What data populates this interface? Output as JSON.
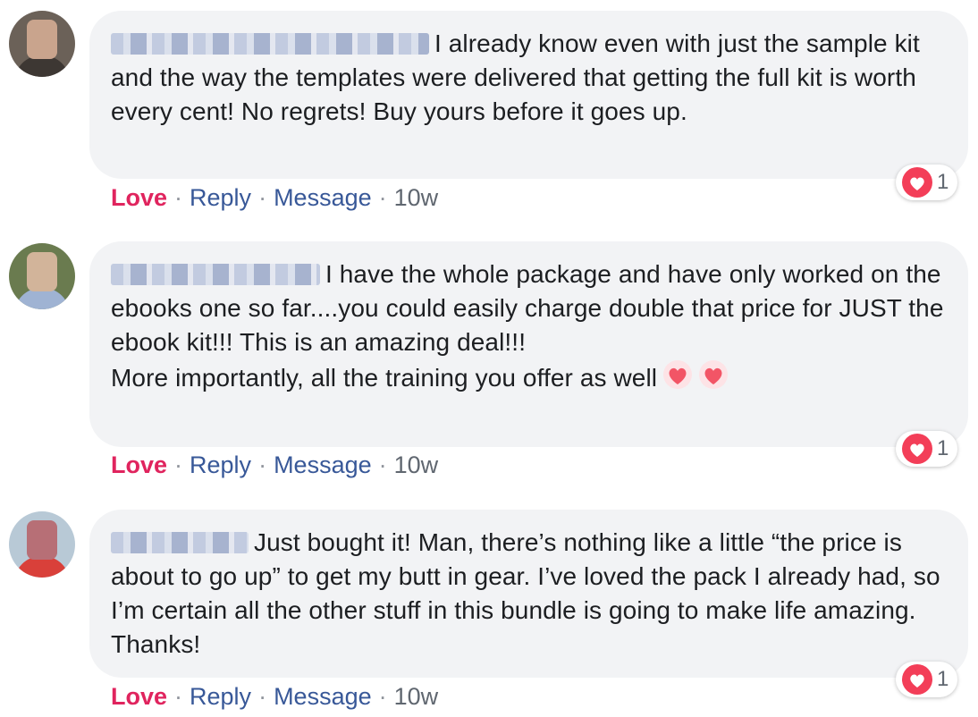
{
  "comments": [
    {
      "avatar_colors": [
        "#6b6158",
        "#3d3733",
        "#c9a48d"
      ],
      "paragraphs": [
        "I already know even with just the sample kit and the way the templates were delivered that getting the full kit is worth every cent! No regrets! Buy yours before it goes up."
      ],
      "reaction": {
        "icon": "heart-icon",
        "count": "1"
      },
      "actions": {
        "love": "Love",
        "reply": "Reply",
        "message": "Message",
        "time": "10w"
      }
    },
    {
      "avatar_colors": [
        "#6a7b4f",
        "#9fb3d3",
        "#d2b49a"
      ],
      "paragraphs": [
        "I have the whole package and have only worked on the ebooks one so far....you could easily charge double that price for JUST the ebook kit!!! This is an amazing deal!!!",
        "More importantly, all the training you offer as well"
      ],
      "emojis": [
        "sparkling-heart-icon",
        "sparkling-heart-icon"
      ],
      "reaction": {
        "icon": "heart-icon",
        "count": "1"
      },
      "actions": {
        "love": "Love",
        "reply": "Reply",
        "message": "Message",
        "time": "10w"
      }
    },
    {
      "avatar_colors": [
        "#b8c9d6",
        "#d9403a",
        "#b76f76"
      ],
      "paragraphs": [
        "Just bought it! Man, there’s nothing like a little “the price is about to go up” to get my butt in gear. I’ve loved the pack I already had, so I’m certain all the other stuff in this bundle is going to make life amazing. Thanks!"
      ],
      "reaction": {
        "icon": "heart-icon",
        "count": "1"
      },
      "actions": {
        "love": "Love",
        "reply": "Reply",
        "message": "Message",
        "time": "10w"
      }
    }
  ],
  "colors": {
    "love": "#e0245e",
    "link": "#385898",
    "bubble": "#f2f3f5",
    "heart": "#f33e58"
  }
}
